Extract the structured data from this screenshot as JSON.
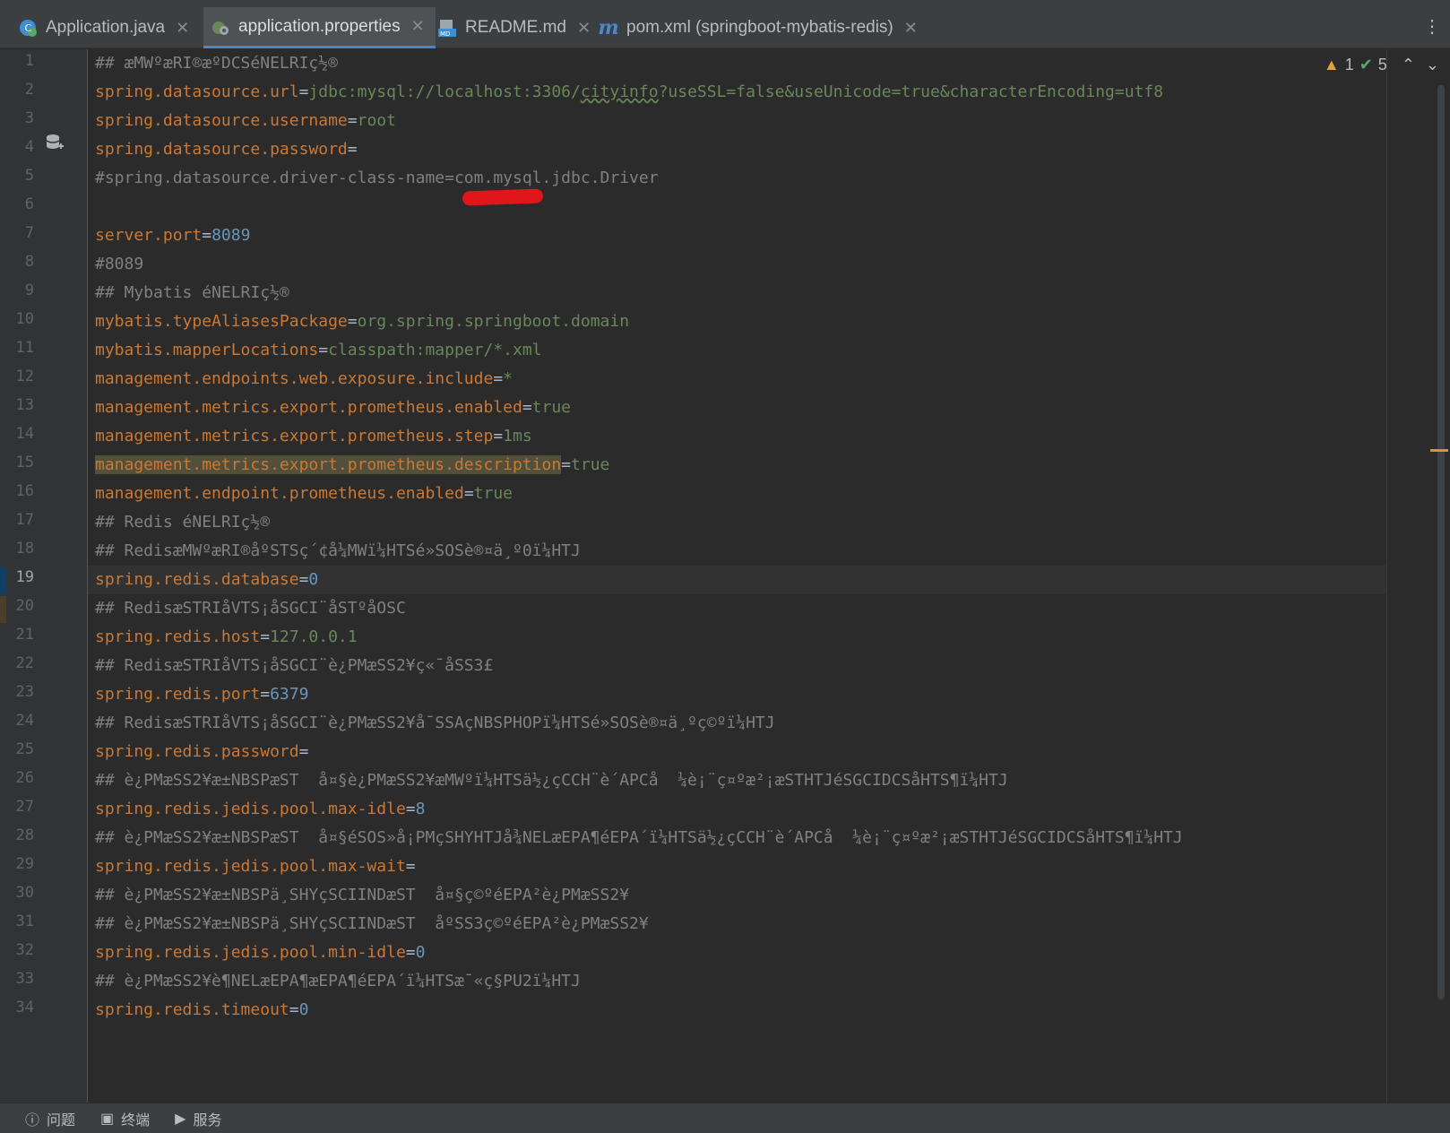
{
  "tabs": [
    {
      "label": "Application.java",
      "icon": "java-class-icon",
      "active": false
    },
    {
      "label": "application.properties",
      "icon": "properties-file-icon",
      "active": true
    },
    {
      "label": "README.md",
      "icon": "markdown-file-icon",
      "active": false
    },
    {
      "label": "pom.xml (springboot-mybatis-redis)",
      "icon": "maven-icon",
      "active": false
    }
  ],
  "inspection": {
    "warnings": "1",
    "ok": "5"
  },
  "current_line": 19,
  "lines": [
    [
      [
        "c",
        "## æMWºæRI®æºDCSéNELRIç½®"
      ]
    ],
    [
      [
        "k",
        "spring.datasource.url"
      ],
      [
        "t",
        "="
      ],
      [
        "v",
        "jdbc:mysql://localhost:3306/"
      ],
      [
        "vu",
        "cityinfo"
      ],
      [
        "v",
        "?useSSL=false&useUnicode=true&characterEncoding=utf8"
      ]
    ],
    [
      [
        "k",
        "spring.datasource.username"
      ],
      [
        "t",
        "="
      ],
      [
        "v",
        "root"
      ]
    ],
    [
      [
        "k",
        "spring.datasource.password"
      ],
      [
        "t",
        "="
      ]
    ],
    [
      [
        "c",
        "#spring.datasource.driver-class-name=com.mysql.jdbc.Driver"
      ]
    ],
    [],
    [
      [
        "k",
        "server.port"
      ],
      [
        "t",
        "="
      ],
      [
        "n",
        "8089"
      ]
    ],
    [
      [
        "c",
        "#8089"
      ]
    ],
    [
      [
        "c",
        "## Mybatis éNELRIç½®"
      ]
    ],
    [
      [
        "k",
        "mybatis.typeAliasesPackage"
      ],
      [
        "t",
        "="
      ],
      [
        "v",
        "org.spring.springboot.domain"
      ]
    ],
    [
      [
        "k",
        "mybatis.mapperLocations"
      ],
      [
        "t",
        "="
      ],
      [
        "v",
        "classpath:mapper/*.xml"
      ]
    ],
    [
      [
        "k",
        "management.endpoints.web.exposure.include"
      ],
      [
        "t",
        "="
      ],
      [
        "v",
        "*"
      ]
    ],
    [
      [
        "k",
        "management.metrics.export.prometheus.enabled"
      ],
      [
        "t",
        "="
      ],
      [
        "v",
        "true"
      ]
    ],
    [
      [
        "k",
        "management.metrics.export.prometheus.step"
      ],
      [
        "t",
        "="
      ],
      [
        "v",
        "1ms"
      ]
    ],
    [
      [
        "kh",
        "management.metrics.export.prometheus.description"
      ],
      [
        "t",
        "="
      ],
      [
        "v",
        "true"
      ]
    ],
    [
      [
        "k",
        "management.endpoint.prometheus.enabled"
      ],
      [
        "t",
        "="
      ],
      [
        "v",
        "true"
      ]
    ],
    [
      [
        "c",
        "## Redis éNELRIç½®"
      ]
    ],
    [
      [
        "c",
        "## RedisæMWºæRI®åºSTSç´¢å¼MWï¼HTSé»SOSè®¤ä¸º0ï¼HTJ"
      ]
    ],
    [
      [
        "k",
        "spring.redis.database"
      ],
      [
        "t",
        "="
      ],
      [
        "n",
        "0"
      ]
    ],
    [
      [
        "c",
        "## RedisæSTRIåVTS¡åSGCI¨åSTºåOSC"
      ]
    ],
    [
      [
        "k",
        "spring.redis.host"
      ],
      [
        "t",
        "="
      ],
      [
        "v",
        "127.0.0.1"
      ]
    ],
    [
      [
        "c",
        "## RedisæSTRIåVTS¡åSGCI¨è¿PMæSS2¥ç«¯åSS3£"
      ]
    ],
    [
      [
        "k",
        "spring.redis.port"
      ],
      [
        "t",
        "="
      ],
      [
        "n",
        "6379"
      ]
    ],
    [
      [
        "c",
        "## RedisæSTRIåVTS¡åSGCI¨è¿PMæSS2¥å¯SSAçNBSPHOPï¼HTSé»SOSè®¤ä¸ºç©ºï¼HTJ"
      ]
    ],
    [
      [
        "k",
        "spring.redis.password"
      ],
      [
        "t",
        "="
      ]
    ],
    [
      [
        "c",
        "## è¿PMæSS2¥æ±NBSPæST  å¤§è¿PMæSS2¥æMWºï¼HTSä½¿çCCH¨è´APCå  ¼è¡¨ç¤ºæ²¡æSTHTJéSGCIDCSåHTS¶ï¼HTJ"
      ]
    ],
    [
      [
        "k",
        "spring.redis.jedis.pool.max-idle"
      ],
      [
        "t",
        "="
      ],
      [
        "n",
        "8"
      ]
    ],
    [
      [
        "c",
        "## è¿PMæSS2¥æ±NBSPæST  å¤§éSOS»å¡PMçSHYHTJå¾NELæEPA¶éEPA´ï¼HTSä½¿çCCH¨è´APCå  ¼è¡¨ç¤ºæ²¡æSTHTJéSGCIDCSåHTS¶ï¼HTJ"
      ]
    ],
    [
      [
        "k",
        "spring.redis.jedis.pool.max-wait"
      ],
      [
        "t",
        "="
      ]
    ],
    [
      [
        "c",
        "## è¿PMæSS2¥æ±NBSPä¸SHYçSCIINDæST  å¤§ç©ºéEPA²è¿PMæSS2¥"
      ]
    ],
    [
      [
        "c",
        "## è¿PMæSS2¥æ±NBSPä¸SHYçSCIINDæST  åºSS3ç©ºéEPA²è¿PMæSS2¥"
      ]
    ],
    [
      [
        "k",
        "spring.redis.jedis.pool.min-idle"
      ],
      [
        "t",
        "="
      ],
      [
        "n",
        "0"
      ]
    ],
    [
      [
        "c",
        "## è¿PMæSS2¥è¶NELæEPA¶æEPA¶éEPA´ï¼HTSæ¯«ç§PU2ï¼HTJ"
      ]
    ],
    [
      [
        "k",
        "spring.redis.timeout"
      ],
      [
        "t",
        "="
      ],
      [
        "n",
        "0"
      ]
    ]
  ],
  "status_bar": [
    {
      "label": "问题",
      "icon": "problems-icon"
    },
    {
      "label": "终端",
      "icon": "terminal-icon"
    },
    {
      "label": "服务",
      "icon": "services-icon"
    }
  ]
}
